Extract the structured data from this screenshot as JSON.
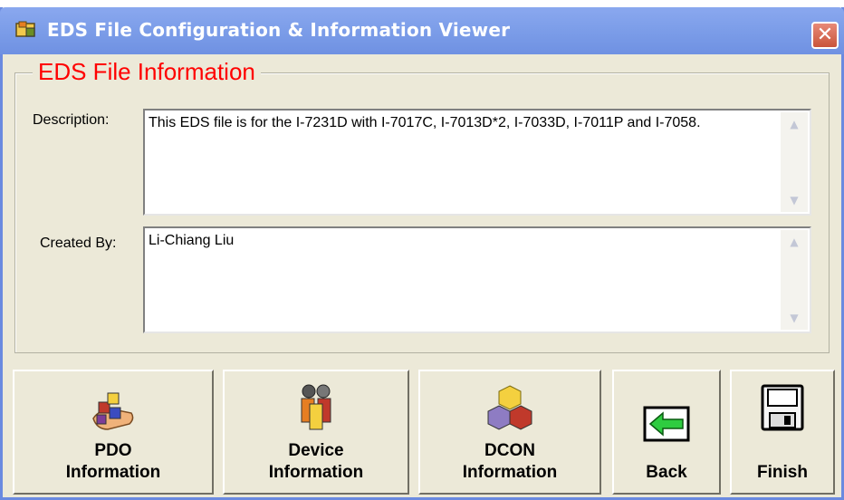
{
  "window": {
    "title": "EDS File Configuration & Information Viewer",
    "close_label": "✕"
  },
  "group": {
    "label": "EDS File Information"
  },
  "description": {
    "label": "Description:",
    "value": "This EDS file is for the I-7231D with I-7017C, I-7013D*2, I-7033D, I-7011P and I-7058."
  },
  "created_by": {
    "label": "Created By:",
    "value": "Li-Chiang Liu"
  },
  "buttons": {
    "pdo": {
      "label": "PDO\nInformation",
      "icon": "pdo-icon"
    },
    "device": {
      "label": "Device\nInformation",
      "icon": "people-icon"
    },
    "dcon": {
      "label": "DCON\nInformation",
      "icon": "cubes-icon"
    },
    "back": {
      "label": "Back",
      "icon": "back-arrow-icon"
    },
    "finish": {
      "label": "Finish",
      "icon": "floppy-disk-icon"
    }
  },
  "colors": {
    "titlebar": "#7d9ee9",
    "group_label": "#ff0000",
    "window_bg": "#ece9d8"
  }
}
